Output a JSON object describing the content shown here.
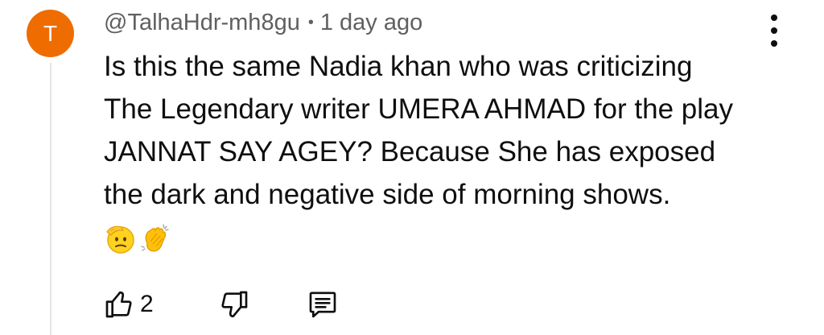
{
  "comment": {
    "avatar_letter": "T",
    "avatar_color": "#ef6c00",
    "author": "@TalhaHdr-mh8gu",
    "separator": "•",
    "timestamp": "1 day ago",
    "lines": [
      "Is this the same Nadia khan who was criticizing",
      "The Legendary writer UMERA AHMAD for the play",
      "JANNAT SAY AGEY? Because She has exposed",
      "the dark and negative side of morning shows."
    ],
    "emojis": [
      "saluting-face",
      "clapping-hands"
    ],
    "like_count": "2"
  },
  "icons": {
    "menu": "more-vertical-icon",
    "like": "thumbs-up-icon",
    "dislike": "thumbs-down-icon",
    "reply": "reply-comment-icon"
  }
}
